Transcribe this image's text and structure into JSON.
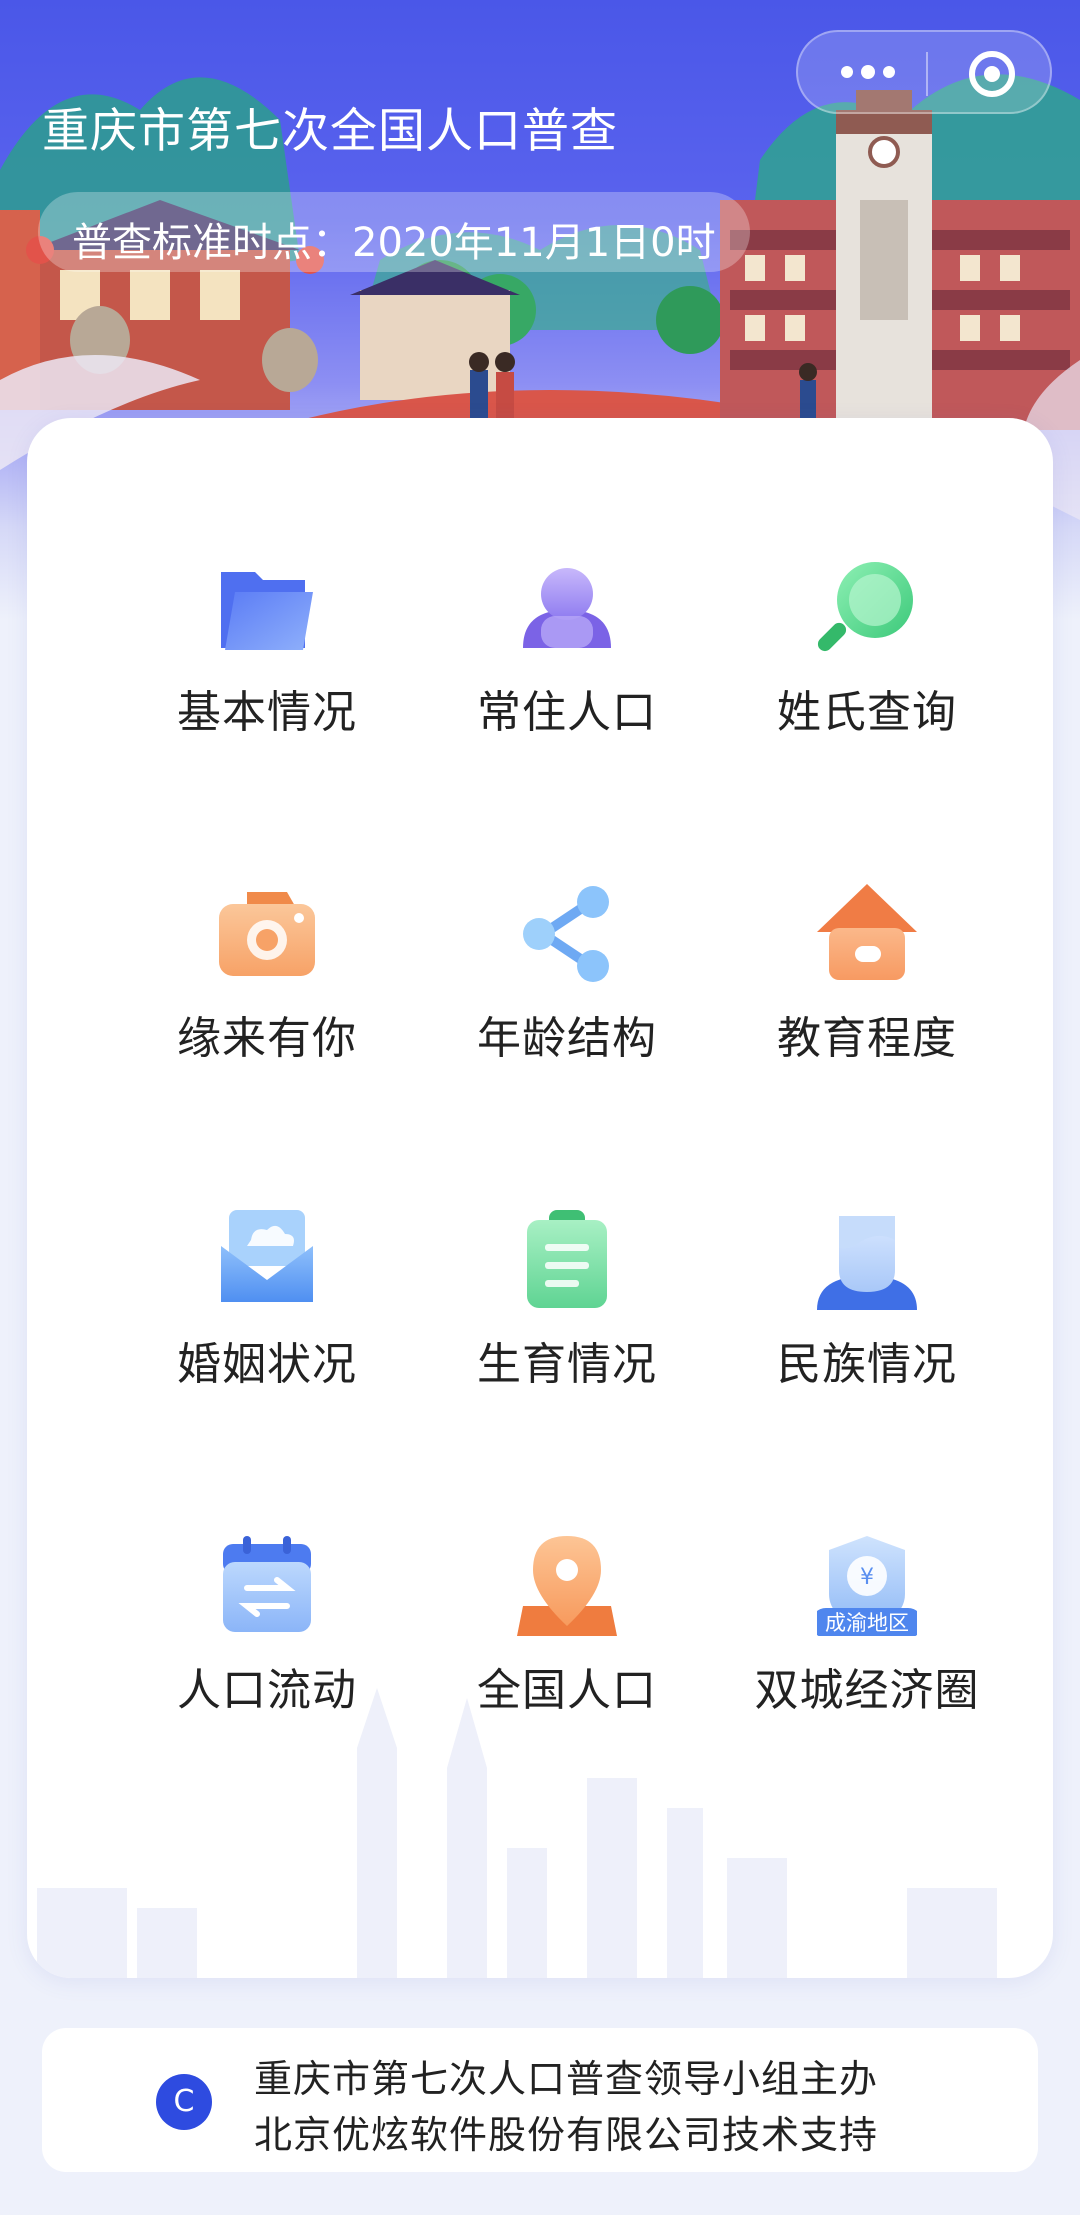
{
  "header": {
    "title": "重庆市第七次全国人口普查",
    "date_label": "普查标准时点：2020年11月1日0时"
  },
  "capsule": {
    "more_icon": "more-dots-icon",
    "close_icon": "miniprogram-close-icon"
  },
  "menu": [
    {
      "label": "基本情况",
      "icon": "folder-icon"
    },
    {
      "label": "常住人口",
      "icon": "person-icon"
    },
    {
      "label": "姓氏查询",
      "icon": "magnifier-icon"
    },
    {
      "label": "缘来有你",
      "icon": "camera-icon"
    },
    {
      "label": "年龄结构",
      "icon": "share-icon"
    },
    {
      "label": "教育程度",
      "icon": "house-icon"
    },
    {
      "label": "婚姻状况",
      "icon": "envelope-icon"
    },
    {
      "label": "生育情况",
      "icon": "clipboard-icon"
    },
    {
      "label": "民族情况",
      "icon": "user-bust-icon"
    },
    {
      "label": "人口流动",
      "icon": "calendar-transfer-icon"
    },
    {
      "label": "全国人口",
      "icon": "location-pin-icon"
    },
    {
      "label": "双城经济圈",
      "icon": "yuan-shield-icon",
      "badge": "成渝地区"
    }
  ],
  "footer": {
    "logo_letter": "C",
    "line1": "重庆市第七次人口普查领导小组主办",
    "line2": "北京优炫软件股份有限公司技术支持"
  },
  "colors": {
    "banner_top": "#4a57e8",
    "accent_blue": "#2e4be0",
    "text_dark": "#222222",
    "page_bg": "#eef1fb"
  }
}
